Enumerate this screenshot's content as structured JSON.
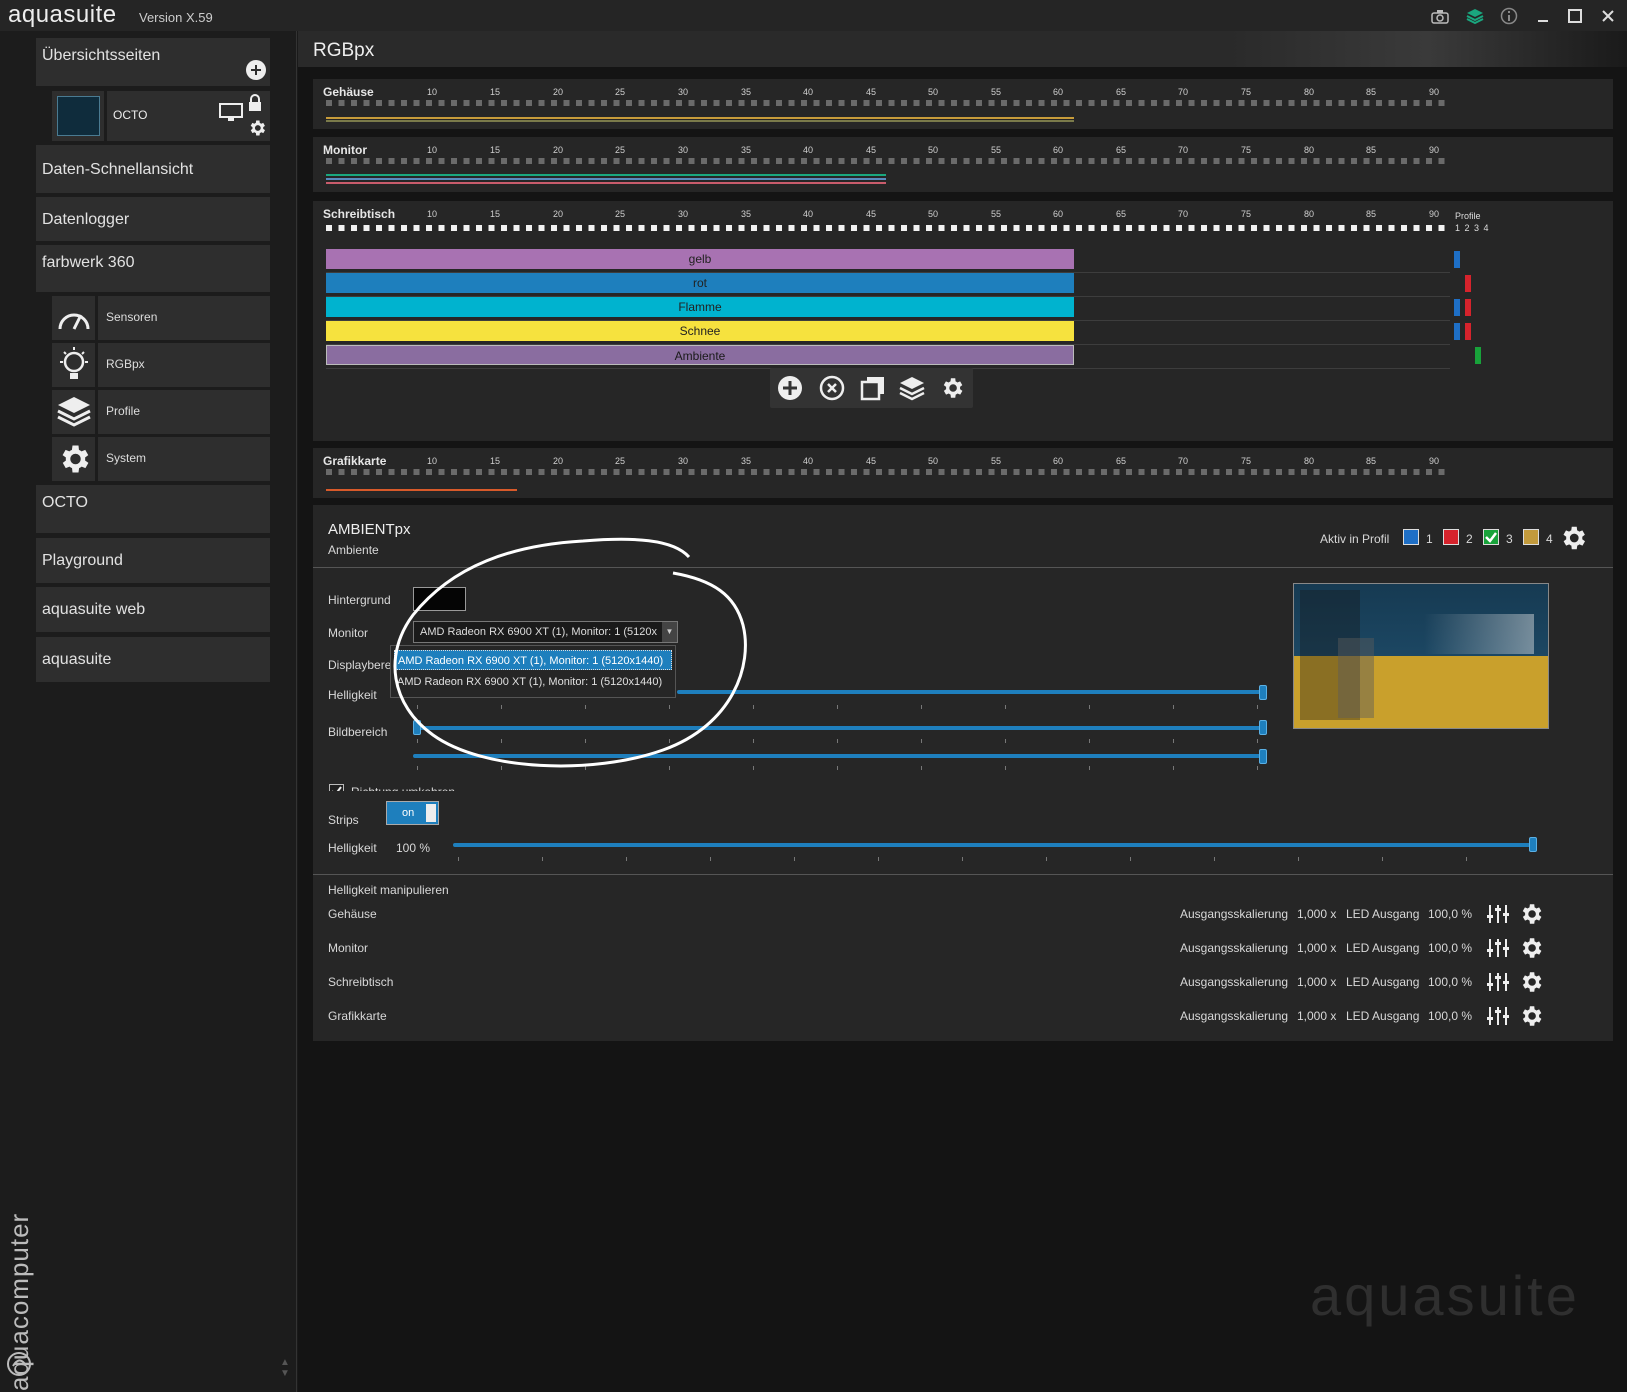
{
  "app": {
    "title": "aquasuite",
    "version": "Version X.59",
    "watermark": "aquasuite",
    "vendor": "aquacomputer"
  },
  "sidebar": {
    "overview": "Übersichtsseiten",
    "octo_device": "OCTO",
    "items": [
      "Daten-Schnellansicht",
      "Datenlogger",
      "farbwerk 360"
    ],
    "sub_items": [
      "Sensoren",
      "RGBpx",
      "Profile",
      "System"
    ],
    "items_bottom": [
      "OCTO",
      "Playground",
      "aquasuite web",
      "aquasuite"
    ]
  },
  "page": {
    "title": "RGBpx"
  },
  "ticks": [
    "10",
    "15",
    "20",
    "25",
    "30",
    "35",
    "40",
    "45",
    "50",
    "55",
    "60",
    "65",
    "70",
    "75",
    "80",
    "85",
    "90"
  ],
  "strips": [
    {
      "name": "Gehäuse"
    },
    {
      "name": "Monitor"
    },
    {
      "name": "Schreibtisch",
      "profile_label": "Profile",
      "profile_numbers": "1 2 3 4"
    },
    {
      "name": "Grafikkarte"
    }
  ],
  "effects": [
    {
      "label": "gelb",
      "color": "#a872b2"
    },
    {
      "label": "rot",
      "color": "#1e7fbd"
    },
    {
      "label": "Flamme",
      "color": "#00b3cf"
    },
    {
      "label": "Schnee",
      "color": "#f6e23e"
    },
    {
      "label": "Ambiente",
      "color": "#8a6da0"
    }
  ],
  "ambient": {
    "title": "AMBIENTpx",
    "subtitle": "Ambiente",
    "active_profile_label": "Aktiv in Profil",
    "profiles": [
      {
        "num": "1",
        "color": "#1e6fc6",
        "checked": false
      },
      {
        "num": "2",
        "color": "#d6232c",
        "checked": false
      },
      {
        "num": "3",
        "color": "#18a23a",
        "checked": true
      },
      {
        "num": "4",
        "color": "#c29a3c",
        "checked": false
      }
    ],
    "background_label": "Hintergrund",
    "monitor_label": "Monitor",
    "monitor_value": "AMD Radeon RX 6900 XT (1), Monitor: 1 (5120x",
    "dropdown_options": [
      "AMD Radeon RX 6900 XT (1), Monitor: 1 (5120x1440)",
      "AMD Radeon RX 6900 XT (1), Monitor: 1 (5120x1440)"
    ],
    "display_label": "Displaybere",
    "brightness_label": "Helligkeit",
    "area_label": "Bildbereich",
    "reverse_label": "Richtung umkehren",
    "reverse_checked": true
  },
  "strips_panel": {
    "strips_label": "Strips",
    "toggle": "on",
    "brightness_label": "Helligkeit",
    "brightness_value": "100 %",
    "brightness_fraction": 1.0,
    "manipulate_label": "Helligkeit manipulieren",
    "rows": [
      {
        "name": "Gehäuse",
        "scale_label": "Ausgangsskalierung",
        "scale": "1,000 x",
        "led_label": "LED Ausgang",
        "led": "100,0 %"
      },
      {
        "name": "Monitor",
        "scale_label": "Ausgangsskalierung",
        "scale": "1,000 x",
        "led_label": "LED Ausgang",
        "led": "100,0 %"
      },
      {
        "name": "Schreibtisch",
        "scale_label": "Ausgangsskalierung",
        "scale": "1,000 x",
        "led_label": "LED Ausgang",
        "led": "100,0 %"
      },
      {
        "name": "Grafikkarte",
        "scale_label": "Ausgangsskalierung",
        "scale": "1,000 x",
        "led_label": "LED Ausgang",
        "led": "100,0 %"
      }
    ]
  }
}
